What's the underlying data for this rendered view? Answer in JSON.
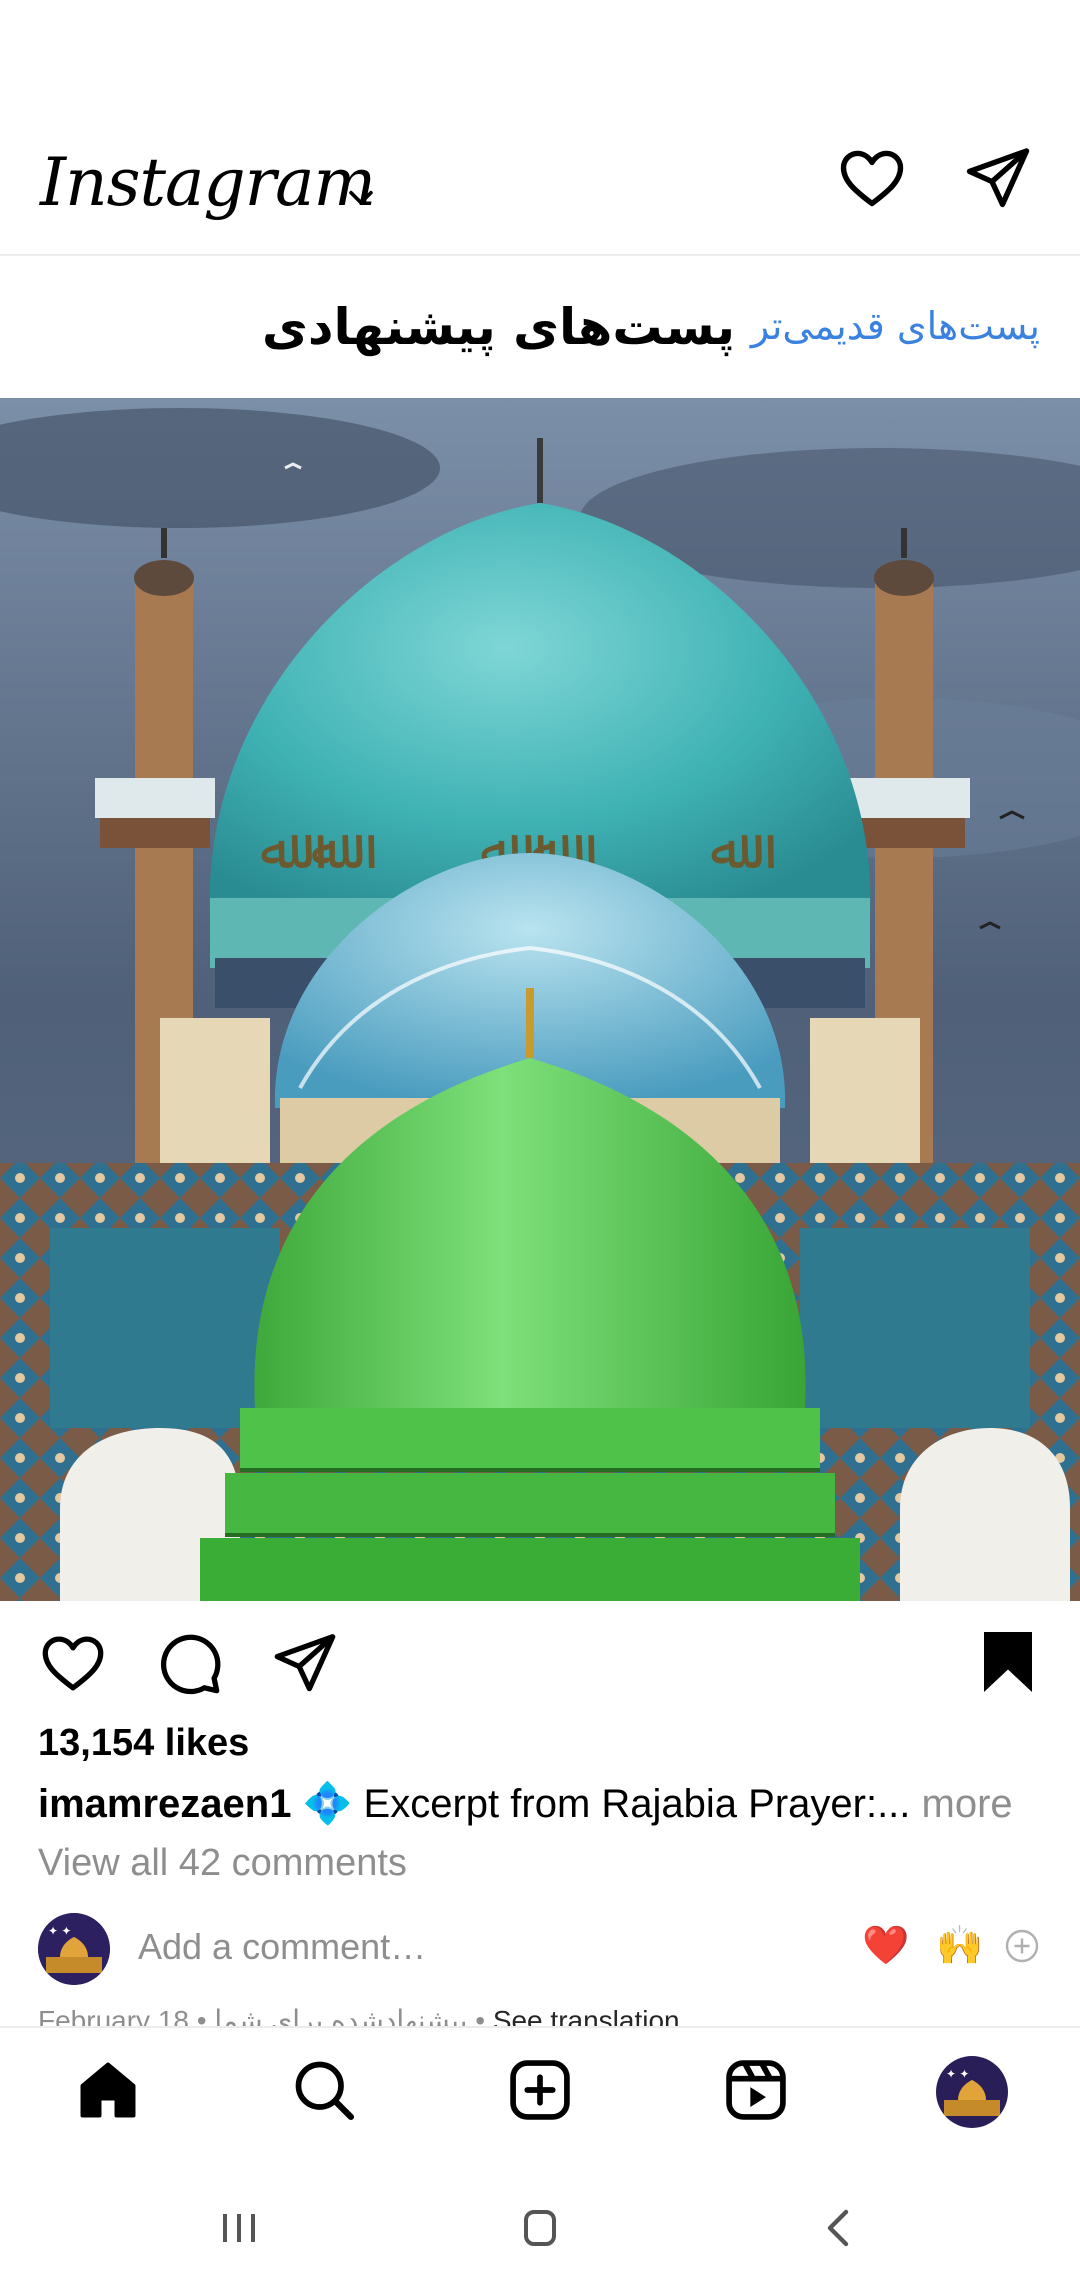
{
  "header": {
    "logo": "Instagram",
    "chevron_icon": "chevron-down-icon",
    "notifications_icon": "heart-icon",
    "messages_icon": "send-icon"
  },
  "suggested": {
    "title": "پست‌های پیشنهادی",
    "older_link": "پست‌های قدیمی‌تر"
  },
  "post": {
    "likes": "13,154 likes",
    "username": "imamrezaen1",
    "caption_emoji": "💠",
    "caption_text": " Excerpt from Rajabia Prayer:...",
    "more_label": " more",
    "view_comments": "View all 42 comments",
    "comment_placeholder": "Add a comment…",
    "quick_reactions": [
      "❤️",
      "🙌"
    ],
    "date": "February 18",
    "suggested_label": "پیشنهادشده برای شما",
    "see_translation": "See translation",
    "saved": true
  },
  "bottom_nav": {
    "items": [
      "home-icon",
      "search-icon",
      "create-icon",
      "reels-icon",
      "profile-avatar"
    ],
    "active": "home"
  },
  "colors": {
    "link_blue": "#3b82e0",
    "muted_gray": "#8e8e8e"
  }
}
